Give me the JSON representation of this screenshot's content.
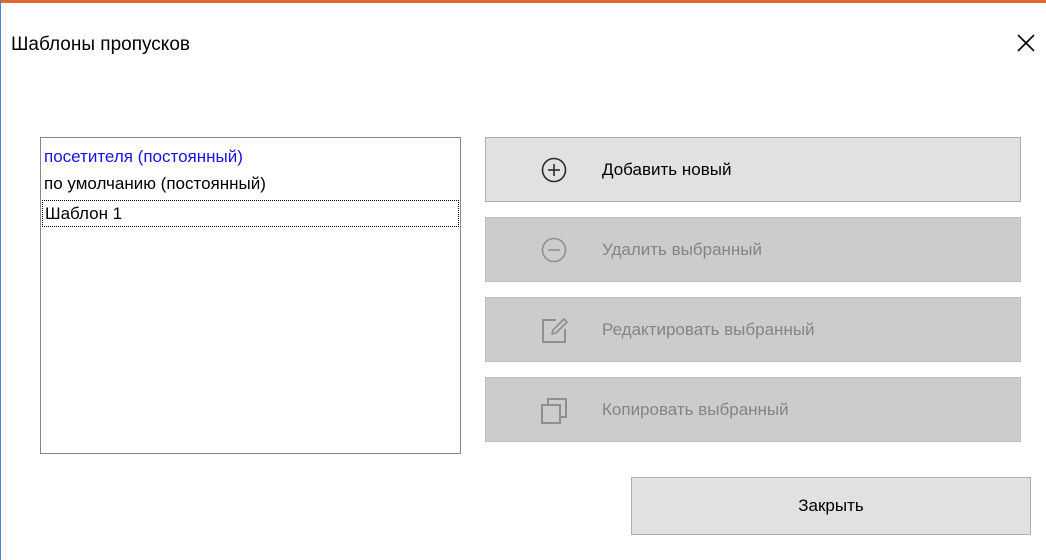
{
  "window": {
    "title": "Шаблоны пропусков",
    "close_icon": "close-icon",
    "accent_color": "#e56a2b"
  },
  "templates_list": {
    "items": [
      {
        "label": "посетителя (постоянный)",
        "color": "#1515e6"
      },
      {
        "label": "по умолчанию (постоянный)",
        "color": "#000000"
      },
      {
        "label": "Шаблон 1",
        "color": "#000000",
        "focused": true
      }
    ]
  },
  "actions": {
    "add": {
      "label": "Добавить новый",
      "icon": "plus-circle-icon",
      "enabled": true
    },
    "delete": {
      "label": "Удалить выбранный",
      "icon": "minus-circle-icon",
      "enabled": false
    },
    "edit": {
      "label": "Редактировать выбранный",
      "icon": "edit-icon",
      "enabled": false
    },
    "copy": {
      "label": "Копировать выбранный",
      "icon": "copy-icon",
      "enabled": false
    }
  },
  "footer": {
    "close_label": "Закрыть"
  }
}
